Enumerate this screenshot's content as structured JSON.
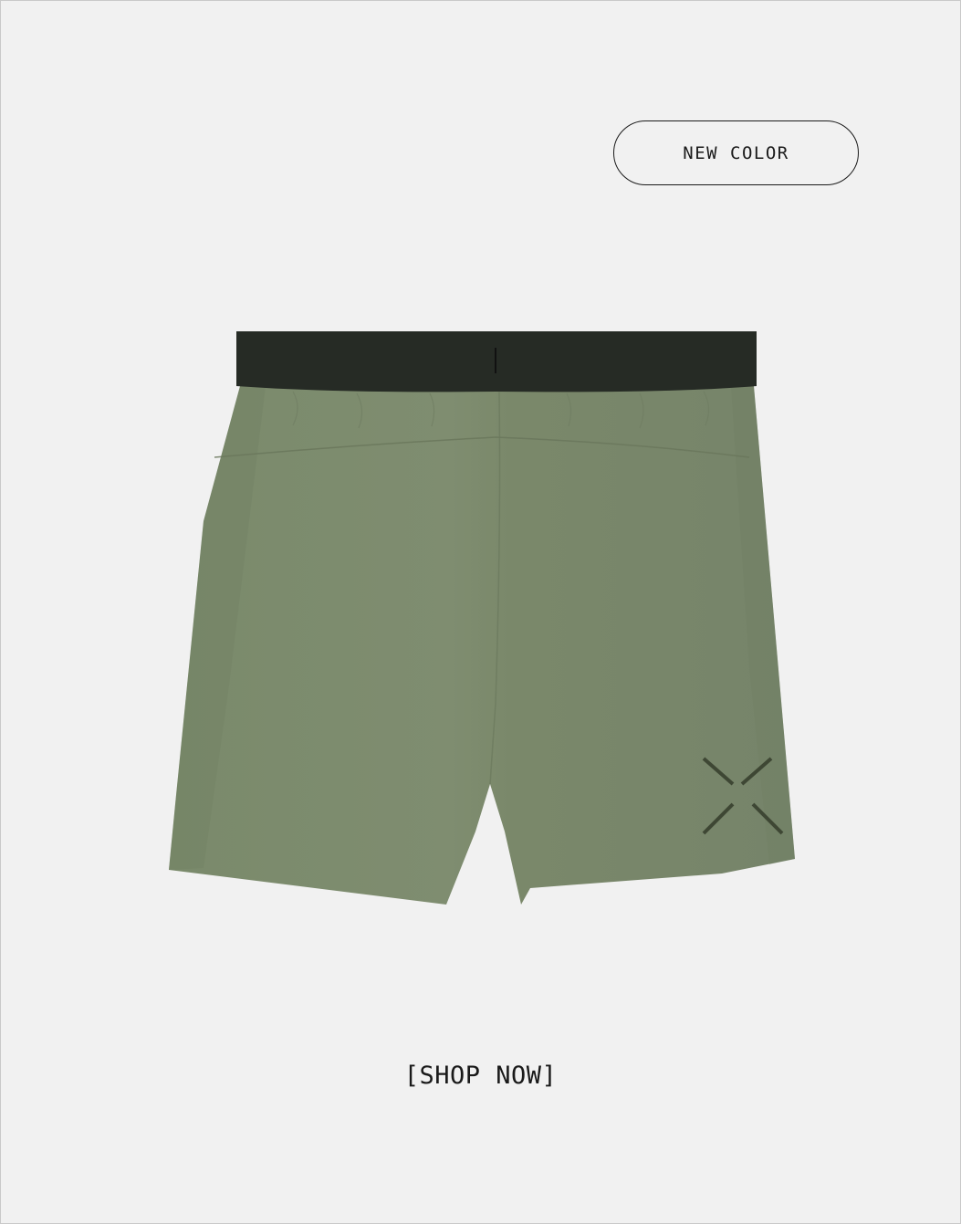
{
  "badge": {
    "label": "NEW COLOR"
  },
  "product": {
    "image_alt": "shorts",
    "colors": {
      "fabric": "#7c8a6c",
      "fabric_shadow": "#6f7d60",
      "waistband": "#262b25",
      "logo": "#3e4734",
      "background": "#f1f1f1"
    }
  },
  "cta": {
    "label": "[SHOP NOW]"
  }
}
